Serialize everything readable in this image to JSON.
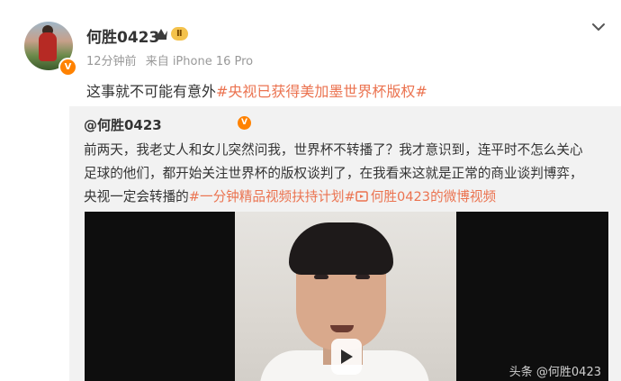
{
  "post": {
    "username": "何胜0423",
    "level": "Ⅱ",
    "time": "12分钟前",
    "source": "来自 iPhone 16 Pro",
    "text_plain": "这事就不可能有意外",
    "hashtag": "#央视已获得美加墨世界杯版权#"
  },
  "repost": {
    "author": "@何胜0423",
    "line1": "前两天，我老丈人和女儿突然问我，世界杯不转播了？我才意识到，连平时不怎么关心",
    "line2": "足球的他们，都开始关注世界杯的版权谈判了，在我看来这就是正常的商业谈判博弈，",
    "line3_plain": "央视一定会转播的",
    "line3_hashtag": "#一分钟精品视频扶持计划#",
    "line3_video_link": "何胜0423的微博视频"
  },
  "video": {
    "watermark": "头条 @何胜0423"
  },
  "icons": {
    "badge": "verified-v-icon",
    "crown": "crown-icon",
    "more": "chevron-down-icon",
    "play": "play-icon",
    "video_link": "video-link-icon"
  },
  "colors": {
    "hashtag": "#eb7350",
    "verified": "#ff8200",
    "repost_bg": "#f2f2f2"
  }
}
